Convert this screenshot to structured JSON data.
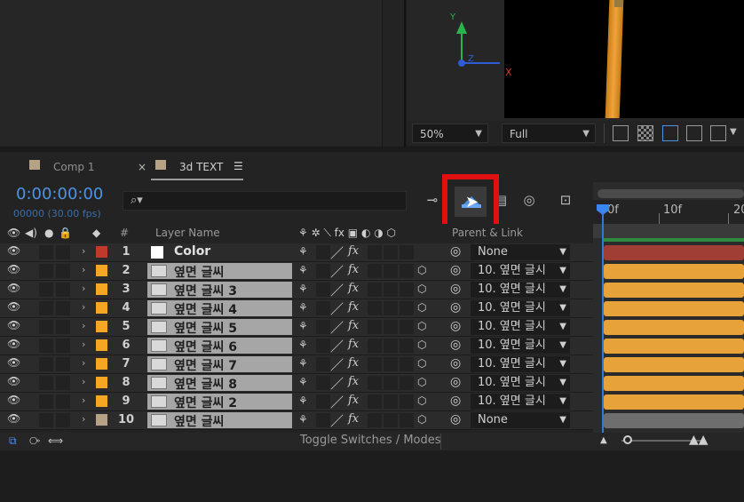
{
  "viewer": {
    "axis_y": "Y",
    "axis_z": "Z",
    "axis_x": "X",
    "zoom": "50%",
    "resolution": "Full"
  },
  "tabs": [
    {
      "label": "Comp 1",
      "close": ""
    },
    {
      "label": "3d TEXT",
      "close": "×",
      "menu": "☰"
    }
  ],
  "timecode": "0:00:00:00",
  "frames_fps": "00000 (30.00 fps)",
  "columns": {
    "layer_name": "Layer Name",
    "number": "#",
    "parent_link": "Parent & Link"
  },
  "ruler": {
    "labels": [
      "0f",
      "10f",
      "20"
    ]
  },
  "layers": [
    {
      "num": "1",
      "name": "Color",
      "label_color": "#c0392b",
      "parent": "None",
      "type": "solid"
    },
    {
      "num": "2",
      "name": "옆면 글씨",
      "label_color": "#f5a623",
      "parent": "10. 옆면 글시",
      "type": "comp"
    },
    {
      "num": "3",
      "name": "옆면 글씨 3",
      "label_color": "#f5a623",
      "parent": "10. 옆면 글시",
      "type": "comp"
    },
    {
      "num": "4",
      "name": "옆면 글씨 4",
      "label_color": "#f5a623",
      "parent": "10. 옆면 글시",
      "type": "comp"
    },
    {
      "num": "5",
      "name": "옆면 글씨 5",
      "label_color": "#f5a623",
      "parent": "10. 옆면 글시",
      "type": "comp"
    },
    {
      "num": "6",
      "name": "옆면 글씨 6",
      "label_color": "#f5a623",
      "parent": "10. 옆면 글시",
      "type": "comp"
    },
    {
      "num": "7",
      "name": "옆면 글씨 7",
      "label_color": "#f5a623",
      "parent": "10. 옆면 글시",
      "type": "comp"
    },
    {
      "num": "8",
      "name": "옆면 글씨 8",
      "label_color": "#f5a623",
      "parent": "10. 옆면 글시",
      "type": "comp"
    },
    {
      "num": "9",
      "name": "옆면 글씨 2",
      "label_color": "#f5a623",
      "parent": "10. 옆면 글시",
      "type": "comp"
    },
    {
      "num": "10",
      "name": "옆면 글씨",
      "label_color": "#b6a386",
      "parent": "None",
      "type": "comp"
    }
  ],
  "bottom": {
    "toggle_label": "Toggle Switches / Modes"
  },
  "colors": {
    "timecode": "#4e93e3",
    "highlight": "#e01010",
    "playhead": "#3577d8",
    "bar_orange": "#e8a23a",
    "bar_red": "#a03d35",
    "bar_gray": "#6e6e6e"
  }
}
